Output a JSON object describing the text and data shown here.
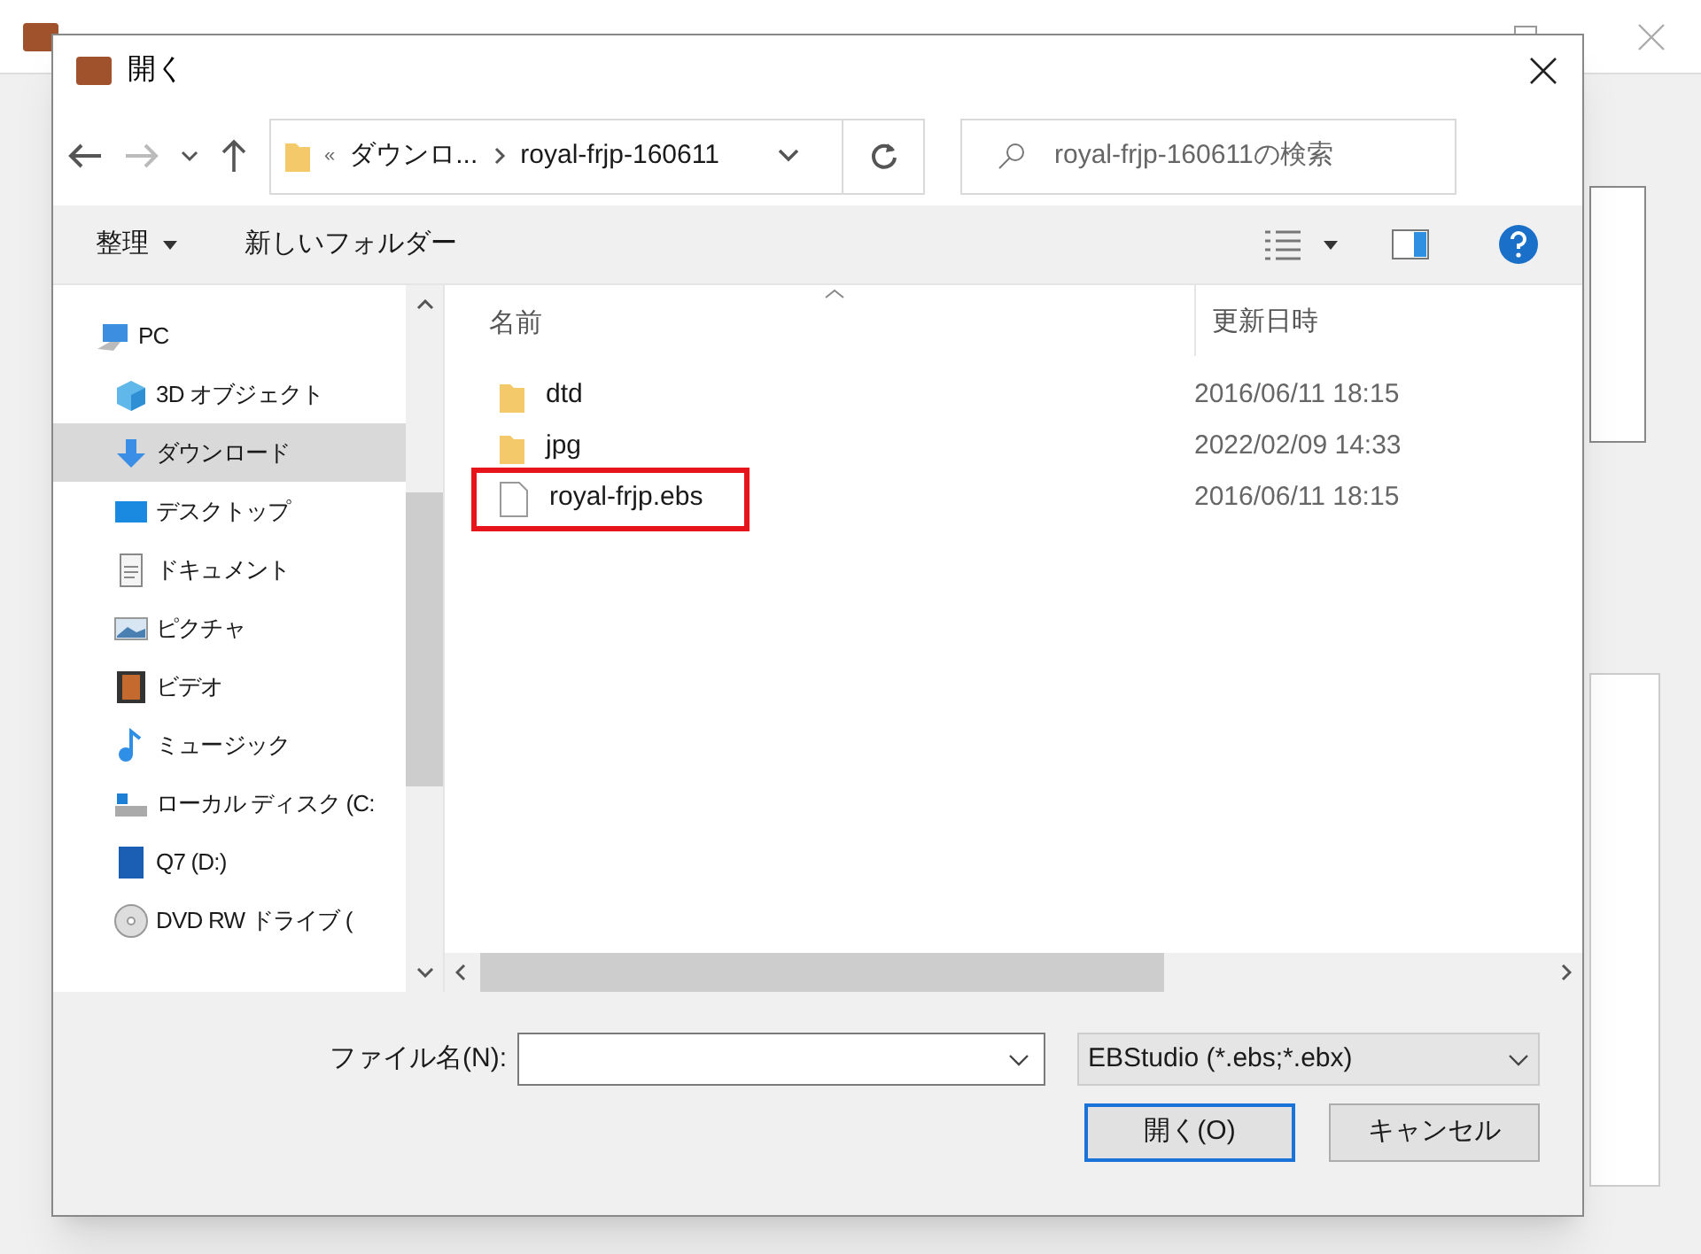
{
  "dialog": {
    "title": "開く"
  },
  "address": {
    "crumbs": [
      "ダウンロ...",
      "royal-frjp-160611"
    ],
    "overflow": "«"
  },
  "search": {
    "placeholder": "royal-frjp-160611の検索"
  },
  "toolbar": {
    "organize": "整理",
    "new_folder": "新しいフォルダー"
  },
  "sidebar": {
    "items": [
      {
        "label": "PC",
        "kind": "pc",
        "selected": false,
        "children": [
          {
            "label": "3D オブジェクト",
            "kind": "cube",
            "selected": false
          },
          {
            "label": "ダウンロード",
            "kind": "download",
            "selected": true
          },
          {
            "label": "デスクトップ",
            "kind": "desktop",
            "selected": false
          },
          {
            "label": "ドキュメント",
            "kind": "document",
            "selected": false
          },
          {
            "label": "ピクチャ",
            "kind": "pictures",
            "selected": false
          },
          {
            "label": "ビデオ",
            "kind": "video",
            "selected": false
          },
          {
            "label": "ミュージック",
            "kind": "music",
            "selected": false
          },
          {
            "label": "ローカル ディスク (C:",
            "kind": "disk",
            "selected": false
          },
          {
            "label": "Q7 (D:)",
            "kind": "sd",
            "selected": false
          },
          {
            "label": "DVD RW ドライブ (",
            "kind": "dvd",
            "selected": false
          }
        ]
      }
    ]
  },
  "table": {
    "columns": [
      "名前",
      "更新日時"
    ],
    "rows": [
      {
        "name": "dtd",
        "date": "2016/06/11 18:15",
        "kind": "folder",
        "marked": false
      },
      {
        "name": "jpg",
        "date": "2022/02/09 14:33",
        "kind": "folder",
        "marked": false
      },
      {
        "name": "royal-frjp.ebs",
        "date": "2016/06/11 18:15",
        "kind": "file",
        "marked": true
      }
    ]
  },
  "footer": {
    "filename_label": "ファイル名(N):",
    "filter": "EBStudio (*.ebs;*.ebx)",
    "open": "開く(O)",
    "cancel": "キャンセル"
  }
}
